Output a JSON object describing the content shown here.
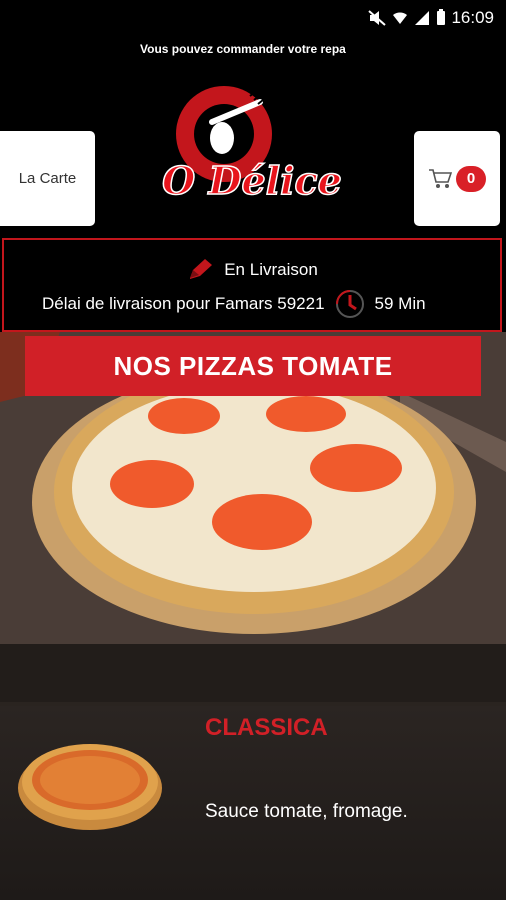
{
  "status_bar": {
    "time": "16:09",
    "icons": [
      "mute-icon",
      "wifi-icon",
      "signal-icon",
      "battery-icon"
    ]
  },
  "header": {
    "marquee_text": "Vous pouvez commander votre repa",
    "brand_name": "O Délice",
    "menu_button_label": "La Carte",
    "cart_count": "0"
  },
  "delivery": {
    "mode_label": "En Livraison",
    "delay_text": "Délai de livraison pour Famars 59221",
    "delay_value": "59 Min"
  },
  "category": {
    "title": "NOS PIZZAS TOMATE"
  },
  "products": [
    {
      "name": "CLASSICA",
      "description": "Sauce tomate, fromage."
    }
  ],
  "colors": {
    "accent": "#d12027",
    "background": "#000000",
    "card_bg": "#2a2420"
  }
}
